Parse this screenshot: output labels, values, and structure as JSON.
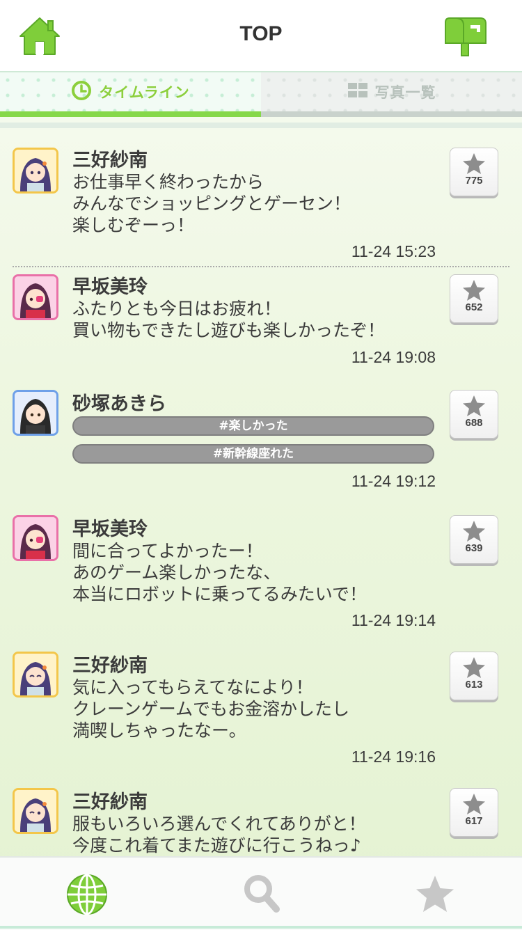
{
  "header": {
    "title": "TOP",
    "home_icon": "home-icon",
    "mail_icon": "mailbox-icon"
  },
  "tabs": [
    {
      "label": "タイムライン",
      "icon": "clock-icon",
      "active": true
    },
    {
      "label": "写真一覧",
      "icon": "grid-icon",
      "active": false
    }
  ],
  "posts": [
    {
      "name": "三好紗南",
      "lines": [
        "お仕事早く終わったから",
        "みんなでショッピングとゲーセン！",
        "楽しむぞーっ！"
      ],
      "time": "11-24 15:23",
      "favorites": "775",
      "avatar_frame": "#f3c64a",
      "hashtags": []
    },
    {
      "name": "早坂美玲",
      "lines": [
        "ふたりとも今日はお疲れ！",
        "買い物もできたし遊びも楽しかったぞ！"
      ],
      "time": "11-24 19:08",
      "favorites": "652",
      "avatar_frame": "#e970a8",
      "hashtags": []
    },
    {
      "name": "砂塚あきら",
      "lines": [],
      "time": "11-24 19:12",
      "favorites": "688",
      "avatar_frame": "#6ea0e8",
      "hashtags": [
        "#楽しかった",
        "#新幹線座れた"
      ]
    },
    {
      "name": "早坂美玲",
      "lines": [
        "間に合ってよかったー！",
        "あのゲーム楽しかったな、",
        "本当にロボットに乗ってるみたいで！"
      ],
      "time": "11-24 19:14",
      "favorites": "639",
      "avatar_frame": "#e970a8",
      "hashtags": []
    },
    {
      "name": "三好紗南",
      "lines": [
        "気に入ってもらえてなにより！",
        "クレーンゲームでもお金溶かしたし",
        "満喫しちゃったなー。"
      ],
      "time": "11-24 19:16",
      "favorites": "613",
      "avatar_frame": "#f3c64a",
      "hashtags": []
    },
    {
      "name": "三好紗南",
      "lines": [
        "服もいろいろ選んでくれてありがと！",
        "今度これ着てまた遊びに行こうねっ♪"
      ],
      "time": "",
      "favorites": "617",
      "avatar_frame": "#f3c64a",
      "hashtags": []
    }
  ],
  "bottom_nav": [
    {
      "icon": "globe-icon",
      "active": true
    },
    {
      "icon": "search-icon",
      "active": false
    },
    {
      "icon": "star-icon",
      "active": false
    }
  ],
  "colors": {
    "accent": "#7fce3a",
    "hashtag_bg": "#9a9a9a",
    "hashtag_text": "#ffffff",
    "text": "#3b3b3b"
  }
}
